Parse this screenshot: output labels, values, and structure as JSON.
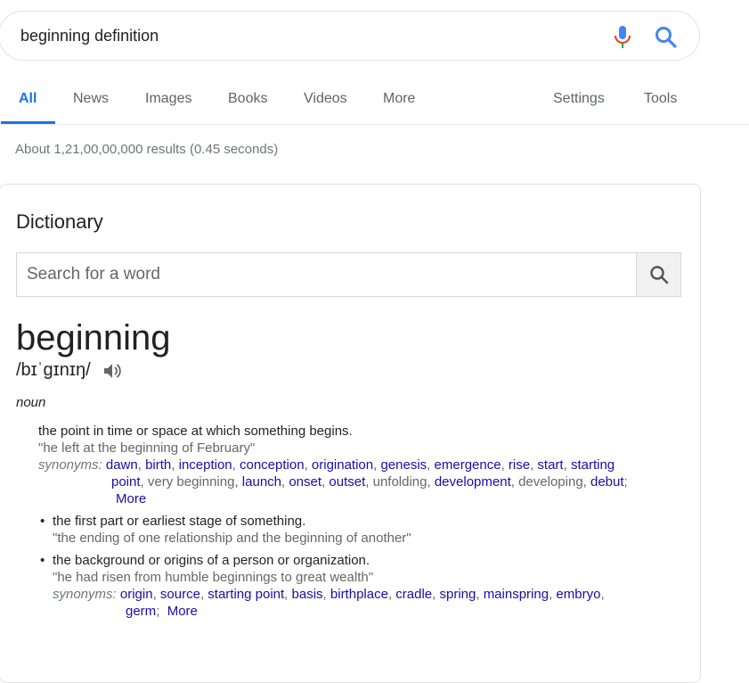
{
  "search": {
    "query": "beginning definition"
  },
  "tabs": {
    "all": "All",
    "news": "News",
    "images": "Images",
    "books": "Books",
    "videos": "Videos",
    "more": "More",
    "settings": "Settings",
    "tools": "Tools"
  },
  "stats": "About 1,21,00,00,000 results (0.45 seconds)",
  "card": {
    "title": "Dictionary",
    "search_placeholder": "Search for a word",
    "word": "beginning",
    "phonetic": "/bɪˈɡɪnɪŋ/",
    "pos": "noun",
    "senses": [
      {
        "definition": "the point in time or space at which something begins.",
        "example": "\"he left at the beginning of February\"",
        "synonyms_label": "synonyms:",
        "syn_line1": [
          "dawn",
          "birth",
          "inception",
          "conception",
          "origination",
          "genesis",
          "emergence",
          "rise",
          "start",
          "starting"
        ],
        "syn_line2_link": "point",
        "syn_line2_plain1": "very beginning",
        "syn_line2_links": [
          "launch",
          "onset",
          "outset"
        ],
        "syn_line2_plain2": "unfolding",
        "syn_line2_link2": "development",
        "syn_line2_plain3": "developing",
        "syn_line2_link3": "debut",
        "more": "More"
      },
      {
        "bullet": "•",
        "definition": "the first part or earliest stage of something.",
        "example": "\"the ending of one relationship and the beginning of another\""
      },
      {
        "bullet": "•",
        "definition": "the background or origins of a person or organization.",
        "example": "\"he had risen from humble beginnings to great wealth\"",
        "synonyms_label": "synonyms:",
        "syn_line1": [
          "origin",
          "source",
          "starting point",
          "basis",
          "birthplace",
          "cradle",
          "spring",
          "mainspring",
          "embryo"
        ],
        "syn_line2": [
          "germ"
        ],
        "more": "More"
      }
    ]
  },
  "colors": {
    "accent": "#1a73e8",
    "link": "#1a0dab",
    "muted": "#70757a"
  }
}
